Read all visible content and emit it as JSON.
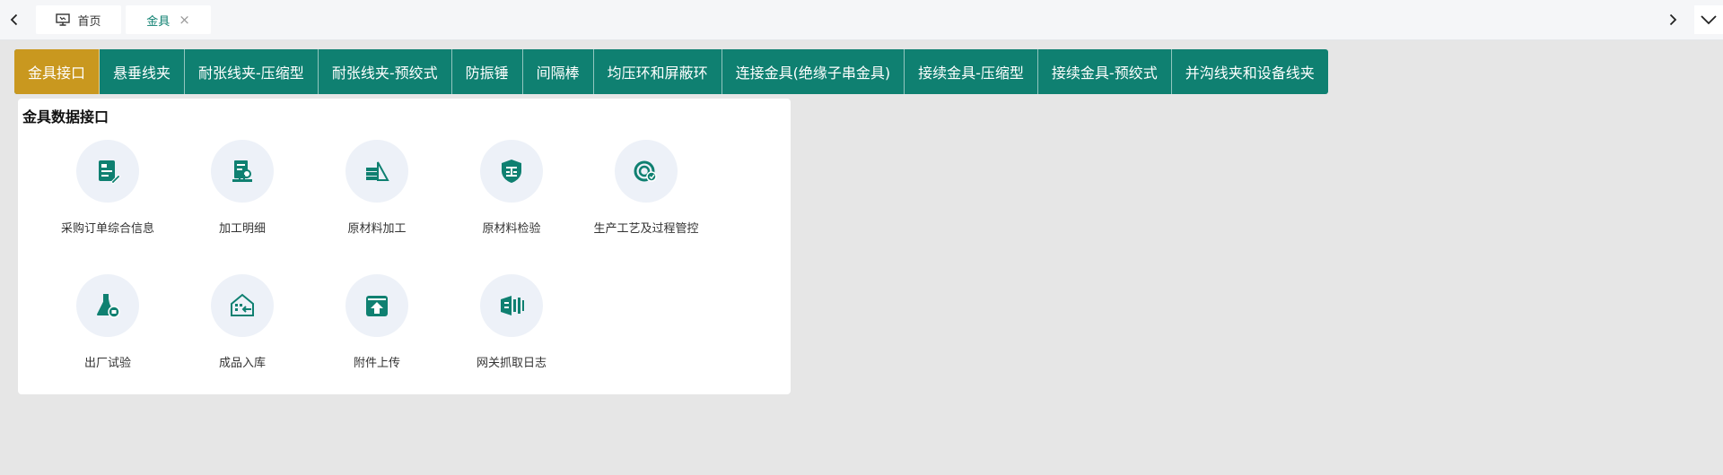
{
  "topbar": {
    "tabs": [
      {
        "label": "首页",
        "icon": "monitor-icon"
      },
      {
        "label": "金具",
        "icon": "close-icon",
        "close": "×"
      }
    ],
    "accent_color": "#0f8071"
  },
  "category_tabs": {
    "items": [
      {
        "label": "金具接口",
        "active": true
      },
      {
        "label": "悬垂线夹"
      },
      {
        "label": "耐张线夹-压缩型"
      },
      {
        "label": "耐张线夹-预绞式"
      },
      {
        "label": "防振锤"
      },
      {
        "label": "间隔棒"
      },
      {
        "label": "均压环和屏蔽环"
      },
      {
        "label": "连接金具(绝缘子串金具)"
      },
      {
        "label": "接续金具-压缩型"
      },
      {
        "label": "接续金具-预绞式"
      },
      {
        "label": "并沟线夹和设备线夹"
      }
    ],
    "primary_color": "#0f8071",
    "active_color": "#c9981f"
  },
  "card": {
    "title": "金具数据接口",
    "tiles": [
      {
        "label": "采购订单综合信息",
        "icon": "purchase-order-icon"
      },
      {
        "label": "加工明细",
        "icon": "processing-detail-icon"
      },
      {
        "label": "原材料加工",
        "icon": "raw-material-processing-icon"
      },
      {
        "label": "原材料检验",
        "icon": "inspection-shield-icon"
      },
      {
        "label": "生产工艺及过程管控",
        "icon": "process-control-icon"
      },
      {
        "label": "出厂试验",
        "icon": "flask-icon"
      },
      {
        "label": "成品入库",
        "icon": "warehouse-in-icon"
      },
      {
        "label": "附件上传",
        "icon": "upload-box-icon"
      },
      {
        "label": "网关抓取日志",
        "icon": "gateway-log-icon"
      }
    ],
    "icon_color": "#0f8071"
  }
}
